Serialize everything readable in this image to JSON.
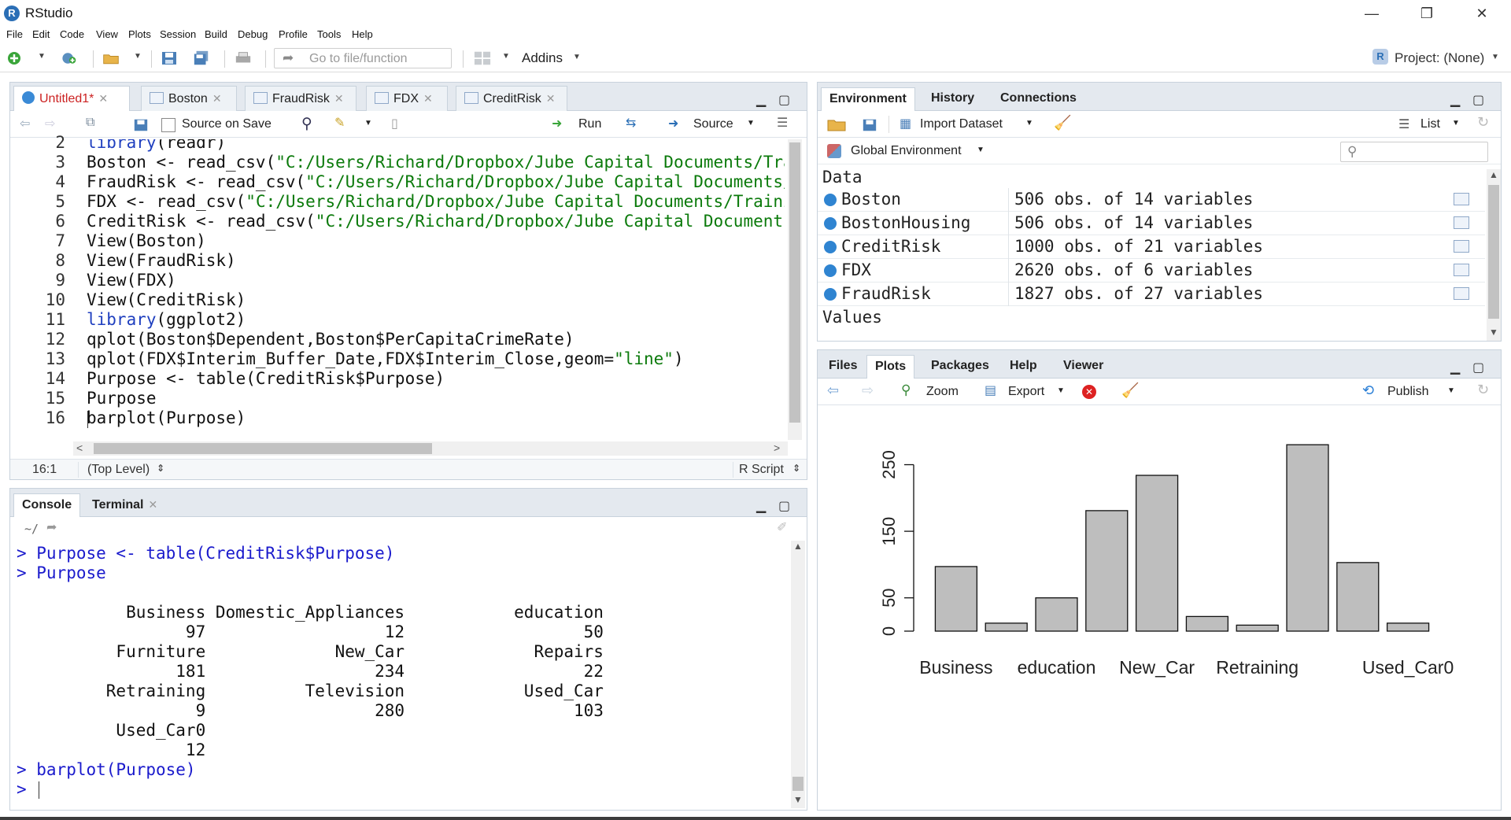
{
  "window": {
    "title": "RStudio",
    "logo": "R",
    "controls": {
      "minimize": "—",
      "maximize": "❐",
      "close": "✕"
    }
  },
  "menu": [
    "File",
    "Edit",
    "Code",
    "View",
    "Plots",
    "Session",
    "Build",
    "Debug",
    "Profile",
    "Tools",
    "Help"
  ],
  "toolbar": {
    "goto_placeholder": "Go to file/function",
    "addins_label": "Addins",
    "project_label": "Project: (None)"
  },
  "editor": {
    "tabs": [
      {
        "label": "Untitled1*",
        "active": true,
        "color": "#cc2222"
      },
      {
        "label": "Boston",
        "active": false
      },
      {
        "label": "FraudRisk",
        "active": false
      },
      {
        "label": "FDX",
        "active": false
      },
      {
        "label": "CreditRisk",
        "active": false
      }
    ],
    "source_on_save_label": "Source on Save",
    "run_label": "Run",
    "source_label": "Source",
    "line_numbers": [
      "2",
      "3",
      "4",
      "5",
      "6",
      "7",
      "8",
      "9",
      "10",
      "11",
      "12",
      "13",
      "14",
      "15",
      "16"
    ],
    "status": {
      "position": "16:1",
      "scope": "(Top Level)",
      "filetype": "R Script"
    }
  },
  "console": {
    "tabs": {
      "console": "Console",
      "terminal": "Terminal"
    },
    "path": "~/",
    "prompt": ">"
  },
  "environment": {
    "tabs": [
      "Environment",
      "History",
      "Connections"
    ],
    "import_label": "Import Dataset",
    "list_label": "List",
    "scope_label": "Global Environment",
    "data_header": "Data",
    "values_header": "Values",
    "rows": [
      {
        "name": "Boston",
        "value": "506 obs. of 14 variables"
      },
      {
        "name": "BostonHousing",
        "value": "506 obs. of 14 variables"
      },
      {
        "name": "CreditRisk",
        "value": "1000 obs. of 21 variables"
      },
      {
        "name": "FDX",
        "value": "2620 obs. of 6 variables"
      },
      {
        "name": "FraudRisk",
        "value": "1827 obs. of 27 variables"
      }
    ]
  },
  "files": {
    "tabs": [
      "Files",
      "Plots",
      "Packages",
      "Help",
      "Viewer"
    ],
    "zoom_label": "Zoom",
    "export_label": "Export",
    "publish_label": "Publish"
  },
  "chart_data": {
    "type": "bar",
    "categories": [
      "Business",
      "Domestic_Appliances",
      "education",
      "Furniture",
      "New_Car",
      "Repairs",
      "Retraining",
      "Television",
      "Used_Car",
      "Used_Car0"
    ],
    "values": [
      97,
      12,
      50,
      181,
      234,
      22,
      9,
      280,
      103,
      12
    ],
    "x_tick_labels": [
      "Business",
      "education",
      "New_Car",
      "Retraining",
      "Used_Car0"
    ],
    "y_ticks": [
      0,
      50,
      150,
      250
    ],
    "ylim": [
      0,
      280
    ],
    "bar_color": "#bebebe",
    "title": "",
    "xlabel": "",
    "ylabel": ""
  }
}
